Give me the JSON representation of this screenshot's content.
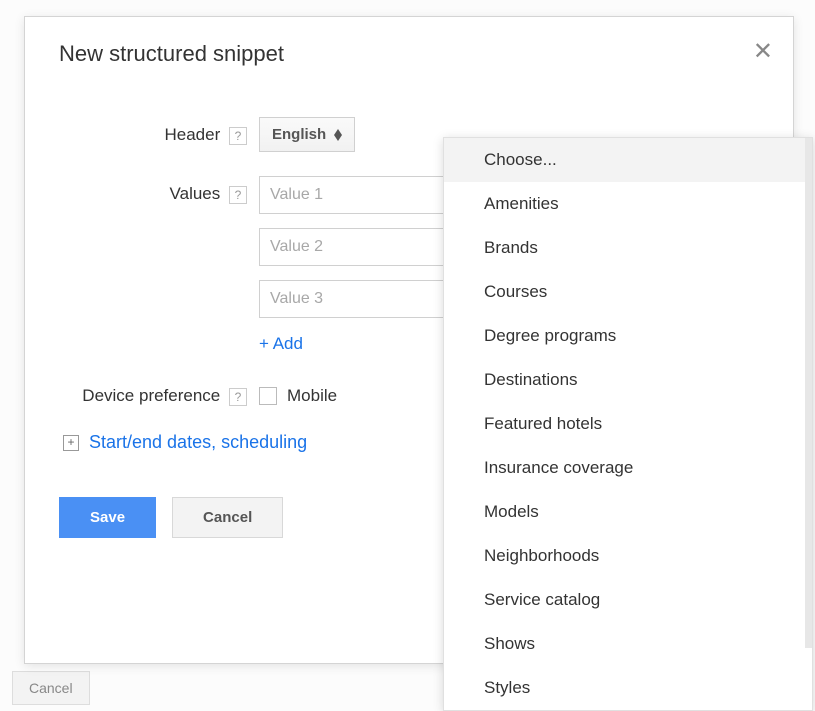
{
  "backdrop": {
    "cancel_label": "Cancel"
  },
  "modal": {
    "title": "New structured snippet",
    "close_glyph": "✕"
  },
  "form": {
    "header_label": "Header",
    "help_glyph": "?",
    "language_selected": "English",
    "values_label": "Values",
    "value_placeholders": [
      "Value 1",
      "Value 2",
      "Value 3"
    ],
    "add_label": "+ Add",
    "device_pref_label": "Device preference",
    "mobile_label": "Mobile",
    "expand_plus": "+",
    "expand_label": "Start/end dates, scheduling",
    "save_label": "Save",
    "cancel_label": "Cancel"
  },
  "dropdown": {
    "items": [
      "Choose...",
      "Amenities",
      "Brands",
      "Courses",
      "Degree programs",
      "Destinations",
      "Featured hotels",
      "Insurance coverage",
      "Models",
      "Neighborhoods",
      "Service catalog",
      "Shows",
      "Styles"
    ],
    "highlighted_index": 0
  }
}
